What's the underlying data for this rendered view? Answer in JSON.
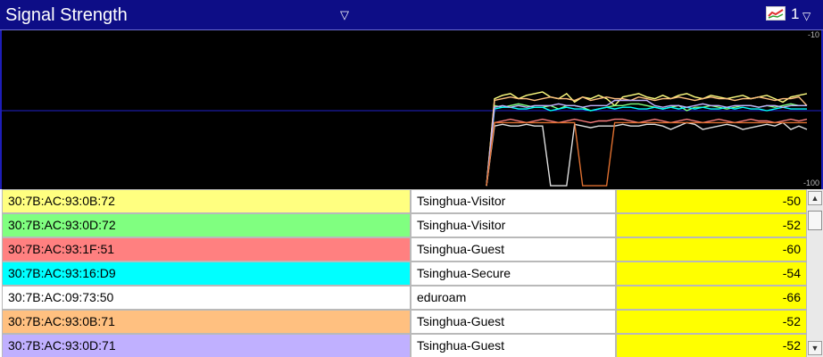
{
  "window": {
    "title": "Signal Strength",
    "title_dropdown_glyph": "▽",
    "series_icon": "line-chart-icon",
    "series_count": "1",
    "series_dropdown_glyph": "▽"
  },
  "chart": {
    "tick_top": "-10",
    "tick_bottom": "-100"
  },
  "chart_data": {
    "type": "line",
    "ylim": [
      -100,
      -10
    ],
    "reference_line_y": -55,
    "grid": false,
    "series": [
      {
        "color": "#ffff80",
        "values": [
          -99,
          -48,
          -46,
          -45,
          -48,
          -46,
          -45,
          -44,
          -47,
          -48,
          -45,
          -50,
          -47,
          -48,
          -46,
          -48,
          -52,
          -47,
          -46,
          -45,
          -47,
          -48,
          -46,
          -48,
          -46,
          -45,
          -47,
          -48,
          -46,
          -47,
          -48,
          -47,
          -46,
          -48,
          -47,
          -46,
          -48,
          -50,
          -47,
          -46,
          -45
        ]
      },
      {
        "color": "#80ff80",
        "values": [
          -99,
          -52,
          -53,
          -52,
          -51,
          -52,
          -53,
          -53,
          -52,
          -54,
          -52,
          -52,
          -53,
          -55,
          -54,
          -53,
          -52,
          -52,
          -51,
          -51,
          -52,
          -53,
          -54,
          -53,
          -52,
          -55,
          -53,
          -53,
          -52,
          -53,
          -54,
          -53,
          -52,
          -52,
          -53,
          -52,
          -53,
          -52,
          -51,
          -52,
          -52
        ]
      },
      {
        "color": "#ff8080",
        "values": [
          -99,
          -62,
          -61,
          -60,
          -61,
          -62,
          -61,
          -60,
          -61,
          -62,
          -61,
          -60,
          -61,
          -62,
          -61,
          -61,
          -60,
          -60,
          -61,
          -62,
          -61,
          -60,
          -61,
          -62,
          -61,
          -60,
          -61,
          -62,
          -61,
          -60,
          -61,
          -62,
          -61,
          -60,
          -61,
          -61,
          -62,
          -61,
          -60,
          -61,
          -60
        ]
      },
      {
        "color": "#00ffff",
        "values": [
          -99,
          -54,
          -53,
          -53,
          -54,
          -54,
          -53,
          -53,
          -55,
          -54,
          -53,
          -54,
          -54,
          -55,
          -54,
          -53,
          -54,
          -53,
          -53,
          -54,
          -54,
          -53,
          -54,
          -53,
          -54,
          -53,
          -54,
          -53,
          -54,
          -54,
          -53,
          -54,
          -53,
          -54,
          -54,
          -55,
          -54,
          -53,
          -54,
          -54,
          -54
        ]
      },
      {
        "color": "#e0e0e0",
        "values": [
          -99,
          -64,
          -63,
          -64,
          -64,
          -63,
          -64,
          -64,
          -99,
          -99,
          -99,
          -63,
          -64,
          -65,
          -64,
          -64,
          -64,
          -63,
          -64,
          -64,
          -63,
          -63,
          -64,
          -66,
          -64,
          -62,
          -63,
          -66,
          -65,
          -64,
          -63,
          -64,
          -66,
          -65,
          -64,
          -63,
          -64,
          -62,
          -66,
          -64,
          -66
        ]
      },
      {
        "color": "#ffc080",
        "values": [
          -99,
          -49,
          -48,
          -47,
          -48,
          -48,
          -49,
          -48,
          -47,
          -48,
          -48,
          -49,
          -47,
          -49,
          -48,
          -47,
          -48,
          -48,
          -49,
          -47,
          -48,
          -49,
          -48,
          -48,
          -47,
          -48,
          -49,
          -48,
          -47,
          -48,
          -48,
          -49,
          -48,
          -48,
          -47,
          -48,
          -49,
          -48,
          -48,
          -47,
          -52
        ]
      },
      {
        "color": "#c0b0ff",
        "values": [
          -99,
          -53,
          -52,
          -53,
          -52,
          -53,
          -52,
          -52,
          -52,
          -51,
          -52,
          -52,
          -53,
          -52,
          -52,
          -52,
          -49,
          -49,
          -49,
          -49,
          -49,
          -52,
          -53,
          -52,
          -52,
          -53,
          -52,
          -51,
          -52,
          -52,
          -53,
          -52,
          -52,
          -52,
          -53,
          -52,
          -52,
          -53,
          -52,
          -52,
          -52
        ]
      },
      {
        "color": "#e07030",
        "values": [
          -99,
          -62,
          -62,
          -62,
          -62,
          -62,
          -62,
          -62,
          -62,
          -62,
          -62,
          -62,
          -99,
          -99,
          -99,
          -99,
          -62,
          -62,
          -62,
          -62,
          -62,
          -62,
          -62,
          -62,
          -62,
          -62,
          -62,
          -62,
          -62,
          -62,
          -62,
          -62,
          -62,
          -62,
          -62,
          -62,
          -62,
          -62,
          -62,
          -62,
          -62
        ]
      }
    ]
  },
  "rows": [
    {
      "mac": "30:7B:AC:93:0B:72",
      "ssid": "Tsinghua-Visitor",
      "rssi": "-50",
      "color": "#ffff80"
    },
    {
      "mac": "30:7B:AC:93:0D:72",
      "ssid": "Tsinghua-Visitor",
      "rssi": "-52",
      "color": "#80ff80"
    },
    {
      "mac": "30:7B:AC:93:1F:51",
      "ssid": "Tsinghua-Guest",
      "rssi": "-60",
      "color": "#ff8080"
    },
    {
      "mac": "30:7B:AC:93:16:D9",
      "ssid": "Tsinghua-Secure",
      "rssi": "-54",
      "color": "#00ffff"
    },
    {
      "mac": "30:7B:AC:09:73:50",
      "ssid": "eduroam",
      "rssi": "-66",
      "color": "#ffffff"
    },
    {
      "mac": "30:7B:AC:93:0B:71",
      "ssid": "Tsinghua-Guest",
      "rssi": "-52",
      "color": "#ffc080"
    },
    {
      "mac": "30:7B:AC:93:0D:71",
      "ssid": "Tsinghua-Guest",
      "rssi": "-52",
      "color": "#c0b0ff"
    }
  ],
  "scrollbar": {
    "up_glyph": "▲",
    "down_glyph": "▼"
  }
}
